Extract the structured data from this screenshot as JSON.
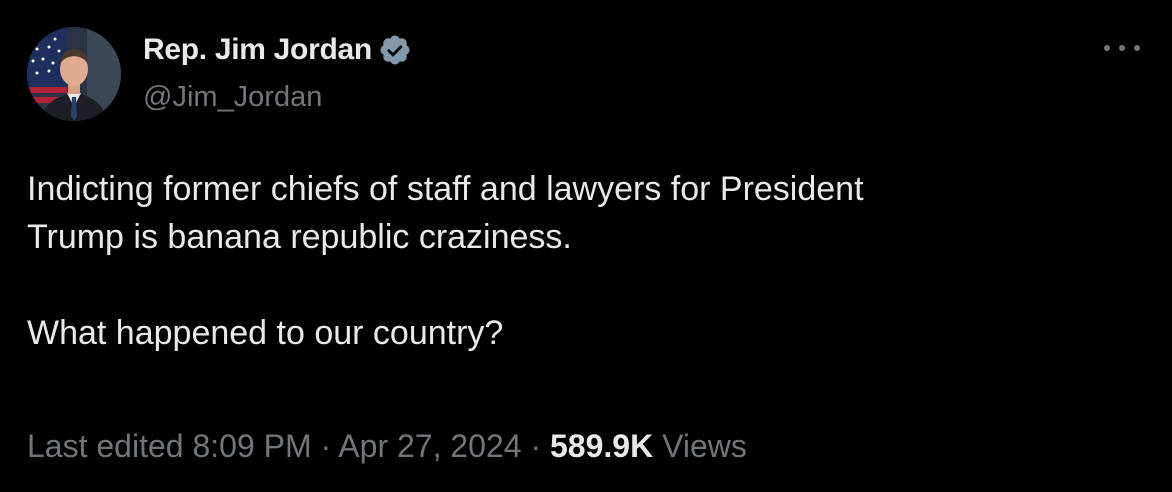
{
  "author": {
    "display_name": "Rep. Jim Jordan",
    "handle": "@Jim_Jordan",
    "verified_color": "#829aab"
  },
  "tweet": {
    "line1": "Indicting former chiefs of staff and lawyers for President",
    "line2": "Trump is banana republic craziness.",
    "line3": "What happened to our country?"
  },
  "meta": {
    "edited_prefix": "Last edited",
    "time": "8:09 PM",
    "separator": "·",
    "date": "Apr 27, 2024",
    "views_count": "589.9K",
    "views_label": "Views"
  },
  "colors": {
    "background": "#000000",
    "primary_text": "#e7e9ea",
    "secondary_text": "#71767b"
  }
}
